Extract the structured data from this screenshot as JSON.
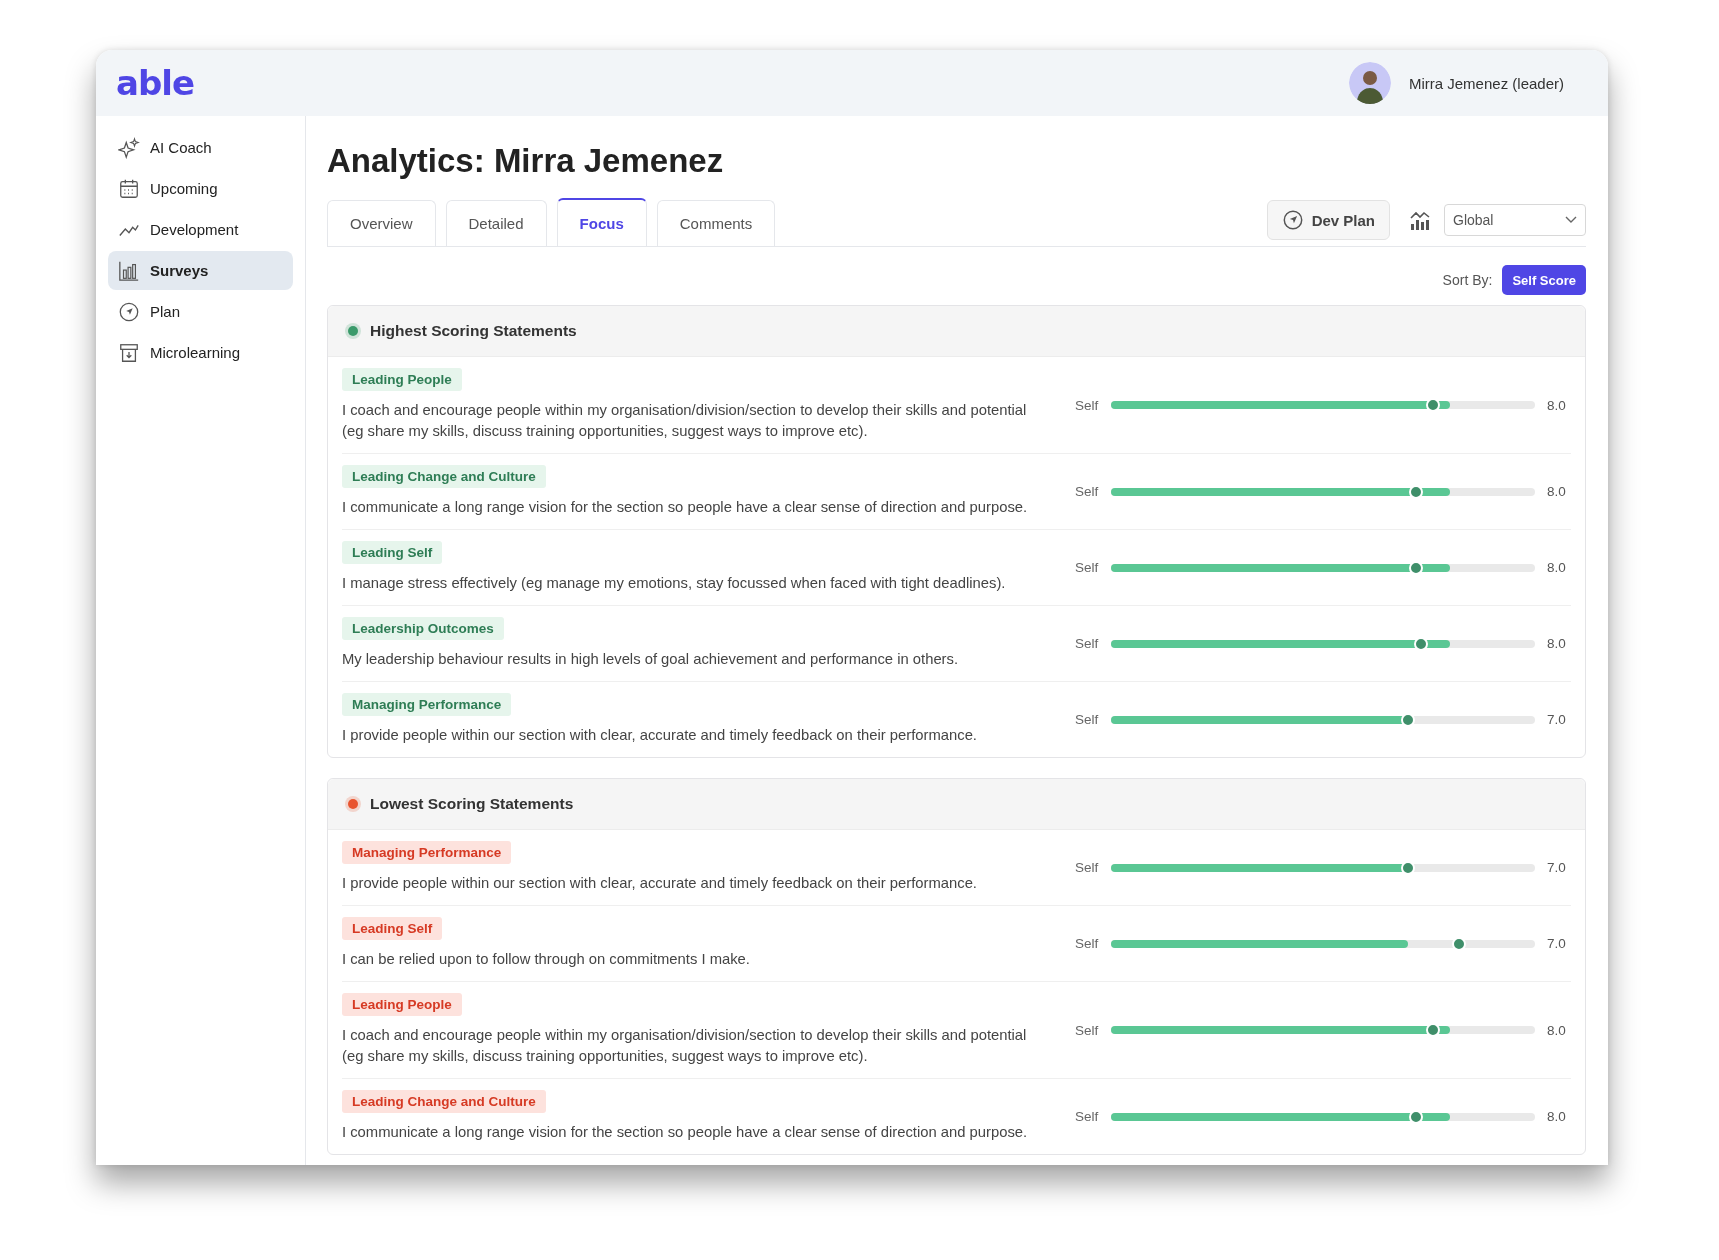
{
  "app": {
    "logo": "able"
  },
  "user": {
    "name": "Mirra Jemenez (leader)"
  },
  "sidebar": {
    "items": [
      {
        "label": "AI Coach",
        "selected": false
      },
      {
        "label": "Upcoming",
        "selected": false
      },
      {
        "label": "Development",
        "selected": false
      },
      {
        "label": "Surveys",
        "selected": true
      },
      {
        "label": "Plan",
        "selected": false
      },
      {
        "label": "Microlearning",
        "selected": false
      }
    ]
  },
  "page": {
    "title": "Analytics: Mirra Jemenez"
  },
  "tabs": [
    {
      "label": "Overview",
      "selected": false
    },
    {
      "label": "Detailed",
      "selected": false
    },
    {
      "label": "Focus",
      "selected": true
    },
    {
      "label": "Comments",
      "selected": false
    }
  ],
  "toolbar": {
    "dev_plan": "Dev Plan",
    "scope": {
      "value": "Global"
    }
  },
  "sort": {
    "label": "Sort By:",
    "option": "Self Score"
  },
  "sections": [
    {
      "title": "Highest Scoring Statements",
      "color": "#3a9a6a",
      "kind": "high",
      "statements": [
        {
          "category": "Leading People",
          "text": "I coach and encourage people within my organisation/division/section to develop their skills and potential (eg share my skills, discuss training opportunities, suggest ways to improve etc).",
          "rater": "Self",
          "score": "8.0",
          "level": 0.8,
          "marker": {
            "level": 0.76
          }
        },
        {
          "category": "Leading Change and Culture",
          "text": "I communicate a long range vision for the section so people have a clear sense of direction and purpose.",
          "rater": "Self",
          "score": "8.0",
          "level": 0.8,
          "marker": {
            "level": 0.72
          }
        },
        {
          "category": "Leading Self",
          "text": "I manage stress effectively (eg manage my emotions, stay focussed when faced with tight deadlines).",
          "rater": "Self",
          "score": "8.0",
          "level": 0.8,
          "marker": {
            "level": 0.72
          }
        },
        {
          "category": "Leadership Outcomes",
          "text": "My leadership behaviour results in high levels of goal achievement and performance in others.",
          "rater": "Self",
          "score": "8.0",
          "level": 0.8,
          "marker": {
            "level": 0.73
          }
        },
        {
          "category": "Managing Performance",
          "text": "I provide people within our section with clear, accurate and timely feedback on their performance.",
          "rater": "Self",
          "score": "7.0",
          "level": 0.7,
          "marker": {
            "level": 0.7
          }
        }
      ]
    },
    {
      "title": "Lowest Scoring Statements",
      "color": "#e8542f",
      "kind": "low",
      "statements": [
        {
          "category": "Managing Performance",
          "text": "I provide people within our section with clear, accurate and timely feedback on their performance.",
          "rater": "Self",
          "score": "7.0",
          "level": 0.7,
          "marker": {
            "level": 0.7
          }
        },
        {
          "category": "Leading Self",
          "text": "I can be relied upon to follow through on commitments I make.",
          "rater": "Self",
          "score": "7.0",
          "level": 0.7,
          "marker": {
            "level": 0.82
          }
        },
        {
          "category": "Leading People",
          "text": "I coach and encourage people within my organisation/division/section to develop their skills and potential (eg share my skills, discuss training opportunities, suggest ways to improve etc).",
          "rater": "Self",
          "score": "8.0",
          "level": 0.8,
          "marker": {
            "level": 0.76
          }
        },
        {
          "category": "Leading Change and Culture",
          "text": "I communicate a long range vision for the section so people have a clear sense of direction and purpose.",
          "rater": "Self",
          "score": "8.0",
          "level": 0.8,
          "marker": {
            "level": 0.72
          }
        }
      ]
    }
  ]
}
